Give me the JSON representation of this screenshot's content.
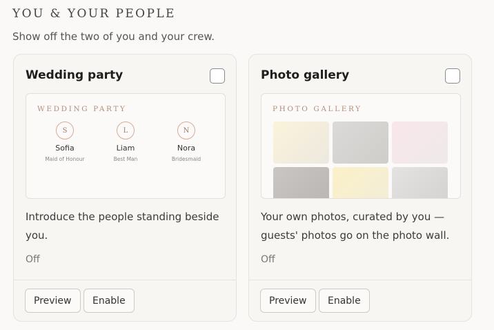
{
  "section": {
    "eyebrow": "YOU & YOUR PEOPLE",
    "subtitle": "Show off the two of you and your crew."
  },
  "cards": [
    {
      "title": "Wedding party",
      "checked": false,
      "preview_heading": "WEDDING PARTY",
      "people": [
        {
          "initial": "S",
          "name": "Sofia",
          "role": "Maid of Honour"
        },
        {
          "initial": "L",
          "name": "Liam",
          "role": "Best Man"
        },
        {
          "initial": "N",
          "name": "Nora",
          "role": "Bridesmaid"
        }
      ],
      "description": "Introduce the people standing beside you.",
      "status": "Off",
      "preview_label": "Preview",
      "enable_label": "Enable"
    },
    {
      "title": "Photo gallery",
      "checked": false,
      "preview_heading": "PHOTO GALLERY",
      "photo_colors": [
        [
          "#fbf3da",
          "#ede8e0"
        ],
        [
          "#dcdad8",
          "#cfcdca"
        ],
        [
          "#f9e6ea",
          "#eeeae9"
        ],
        [
          "#c9c6c3",
          "#b8b5b2"
        ],
        [
          "#fbf1c7",
          "#f2edd9"
        ],
        [
          "#e4e3e2",
          "#d2d1d0"
        ]
      ],
      "description": "Your own photos, curated by you — guests' photos go on the photo wall.",
      "status": "Off",
      "preview_label": "Preview",
      "enable_label": "Enable"
    }
  ],
  "colors": {
    "accent_text": "#b48d7a",
    "accent_ring": "#d4ab97"
  }
}
